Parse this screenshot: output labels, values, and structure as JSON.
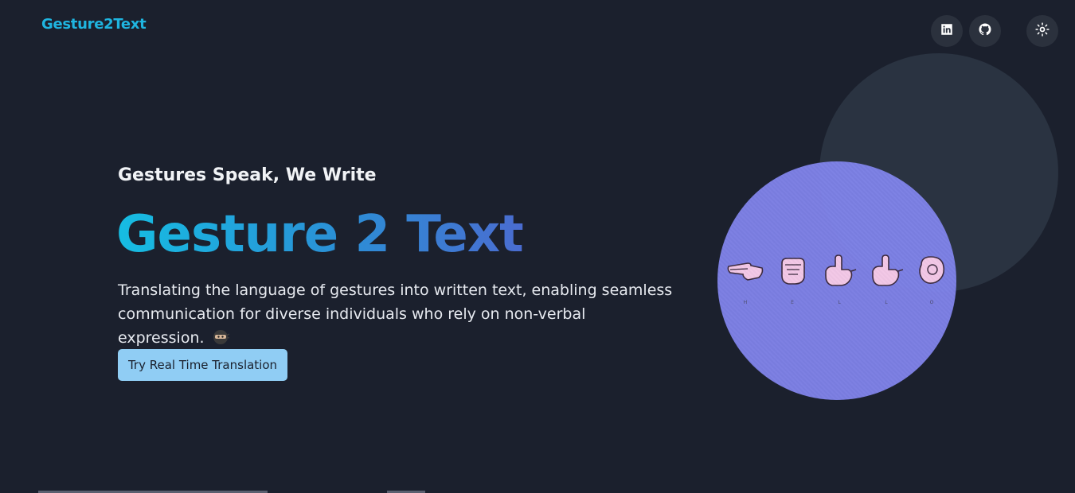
{
  "brand": "Gesture2Text",
  "nav": {
    "linkedin_icon": "linkedin-icon",
    "github_icon": "github-icon",
    "theme_icon": "sun-icon"
  },
  "hero": {
    "subtitle": "Gestures Speak, We Write",
    "title": "Gesture 2 Text",
    "description": "Translating the language of gestures into written text, enabling seamless communication for diverse individuals who rely on non-verbal expression.",
    "cta_label": "Try Real Time Translation"
  },
  "sign_image": {
    "letters": [
      "H",
      "E",
      "L",
      "L",
      "O"
    ]
  },
  "colors": {
    "background": "#1b202d",
    "brand": "#1fb5e0",
    "title_gradient": [
      "#16bde2",
      "#4a6cd0"
    ],
    "button": "#90cdf4",
    "circle": "#7f82ea"
  }
}
